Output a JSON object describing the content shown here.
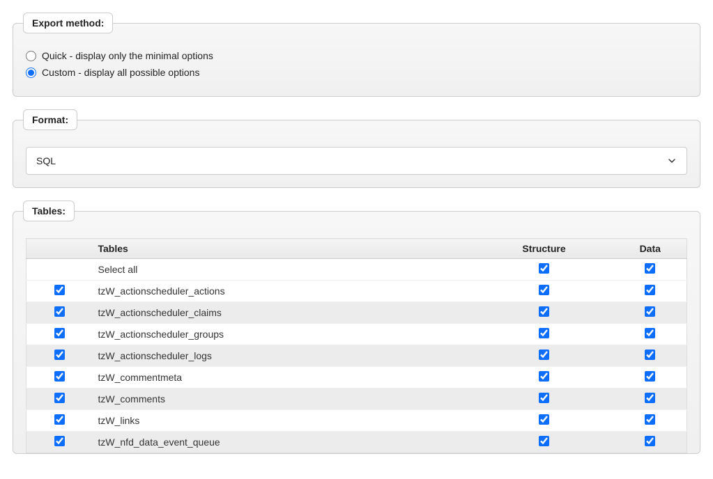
{
  "exportMethod": {
    "legend": "Export method:",
    "quickLabel": "Quick - display only the minimal options",
    "customLabel": "Custom - display all possible options",
    "selected": "custom"
  },
  "format": {
    "legend": "Format:",
    "value": "SQL"
  },
  "tables": {
    "legend": "Tables:",
    "headers": {
      "tables": "Tables",
      "structure": "Structure",
      "data": "Data"
    },
    "selectAllLabel": "Select all",
    "rows": [
      {
        "name": "tzW_actionscheduler_actions",
        "selected": true,
        "structure": true,
        "data": true
      },
      {
        "name": "tzW_actionscheduler_claims",
        "selected": true,
        "structure": true,
        "data": true
      },
      {
        "name": "tzW_actionscheduler_groups",
        "selected": true,
        "structure": true,
        "data": true
      },
      {
        "name": "tzW_actionscheduler_logs",
        "selected": true,
        "structure": true,
        "data": true
      },
      {
        "name": "tzW_commentmeta",
        "selected": true,
        "structure": true,
        "data": true
      },
      {
        "name": "tzW_comments",
        "selected": true,
        "structure": true,
        "data": true
      },
      {
        "name": "tzW_links",
        "selected": true,
        "structure": true,
        "data": true
      },
      {
        "name": "tzW_nfd_data_event_queue",
        "selected": true,
        "structure": true,
        "data": true
      }
    ]
  }
}
